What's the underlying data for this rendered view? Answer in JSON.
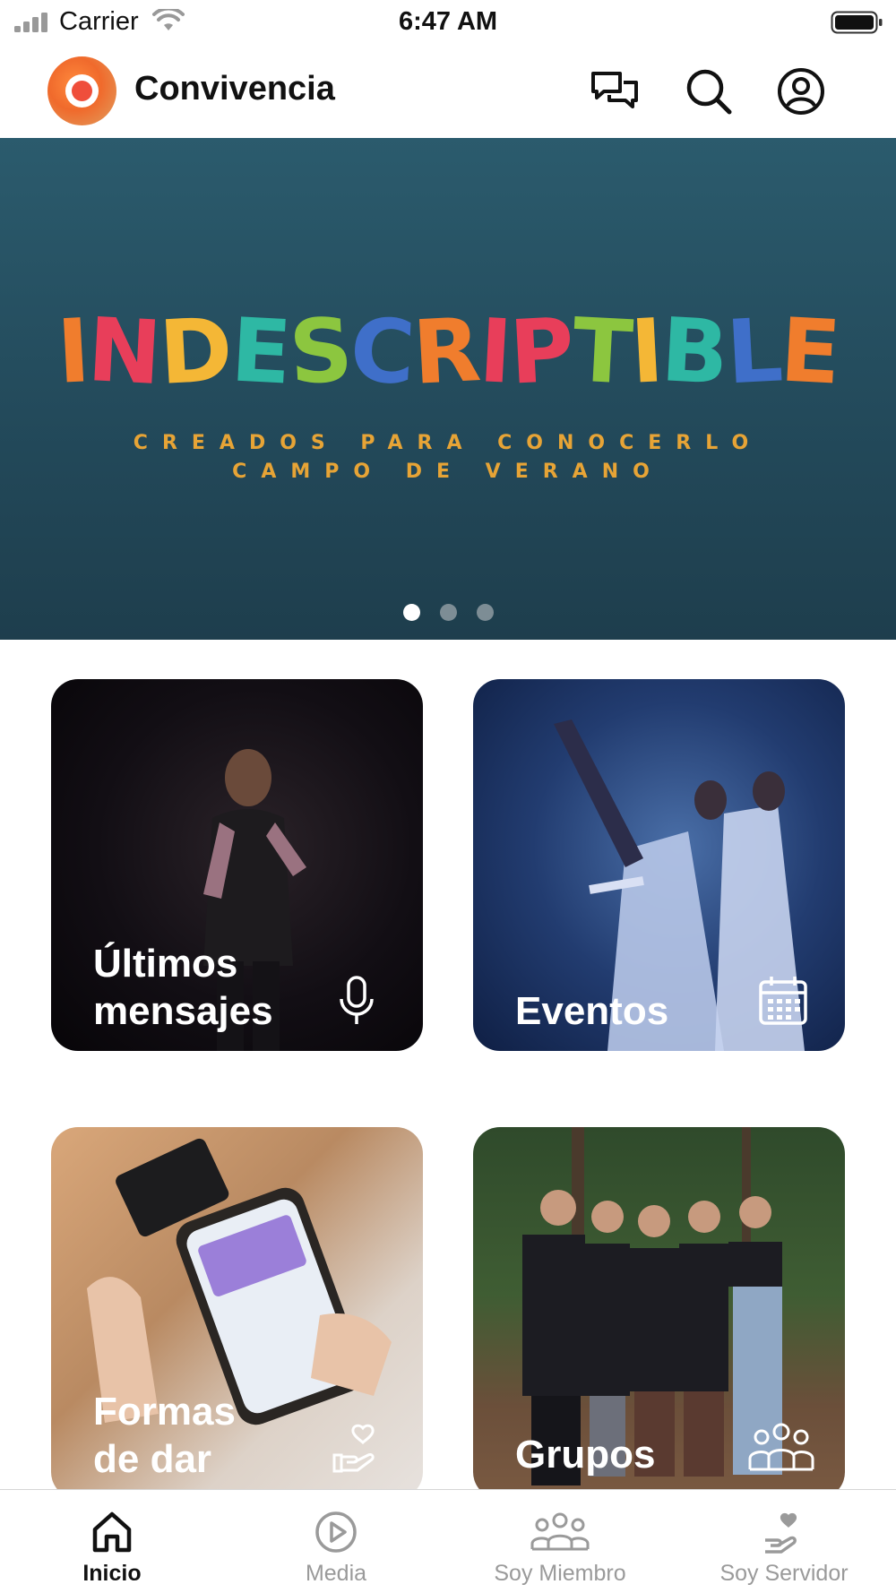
{
  "status_bar": {
    "carrier": "Carrier",
    "time": "6:47 AM",
    "icons": [
      "signal-icon",
      "wifi-icon",
      "battery-icon"
    ]
  },
  "header": {
    "app_name": "Convivencia",
    "icons": [
      "chat-icon",
      "search-icon",
      "profile-icon"
    ]
  },
  "banner": {
    "title_letters": [
      {
        "char": "I",
        "color": "#f07d2d"
      },
      {
        "char": "N",
        "color": "#e83e5a"
      },
      {
        "char": "D",
        "color": "#f4b736"
      },
      {
        "char": "E",
        "color": "#2eb8a4"
      },
      {
        "char": "S",
        "color": "#8cc63f"
      },
      {
        "char": "C",
        "color": "#3f6fc9"
      },
      {
        "char": "R",
        "color": "#f07d2d"
      },
      {
        "char": "I",
        "color": "#e83e5a"
      },
      {
        "char": "P",
        "color": "#e83e5a"
      },
      {
        "char": "T",
        "color": "#8cc63f"
      },
      {
        "char": "I",
        "color": "#f4b736"
      },
      {
        "char": "B",
        "color": "#2eb8a4"
      },
      {
        "char": "L",
        "color": "#3f6fc9"
      },
      {
        "char": "E",
        "color": "#f07d2d"
      }
    ],
    "subtitle_1": "CREADOS PARA CONOCERLO",
    "subtitle_2": "CAMPO DE VERANO",
    "page_count": 3,
    "active_page": 1
  },
  "tiles": [
    {
      "id": "mensajes",
      "label": "Últimos mensajes",
      "icon": "microphone-icon"
    },
    {
      "id": "eventos",
      "label": "Eventos",
      "icon": "calendar-icon"
    },
    {
      "id": "dar",
      "label": "Formas de dar",
      "icon": "giving-hand-icon"
    },
    {
      "id": "grupos",
      "label": "Grupos",
      "icon": "group-icon"
    }
  ],
  "tile_labels": {
    "mensajes_line1": "Últimos",
    "mensajes_line2": "mensajes",
    "eventos": "Eventos",
    "dar_line1": "Formas",
    "dar_line2": "de dar",
    "grupos": "Grupos"
  },
  "bottom_nav": [
    {
      "label": "Inicio",
      "icon": "home-icon",
      "active": true
    },
    {
      "label": "Media",
      "icon": "play-icon",
      "active": false
    },
    {
      "label": "Soy Miembro",
      "icon": "members-icon",
      "active": false
    },
    {
      "label": "Soy Servidor",
      "icon": "servant-icon",
      "active": false
    }
  ],
  "colors": {
    "accent_orange": "#f06a2c",
    "banner_bg": "#234a5b",
    "subtitle_gold": "#e7a436",
    "nav_active": "#111111",
    "nav_inactive": "#9a9a9a"
  }
}
